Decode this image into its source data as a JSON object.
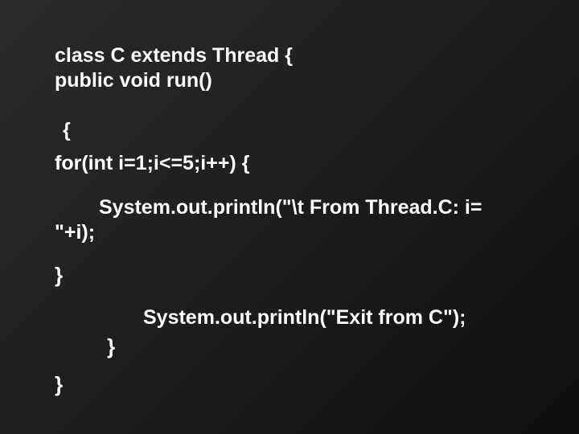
{
  "code": {
    "line1": "class C extends Thread {",
    "line2": "public void run()",
    "brace_open": "{",
    "for_line": "for(int i=1;i<=5;i++) {",
    "print1_a": "System.out.println(\"\\t From Thread.C: i=",
    "print1_b": "\"+i);",
    "brace_close1": "}",
    "print2": "System.out.println(\"Exit from C\");",
    "brace_close2": "}",
    "brace_close3": "}"
  }
}
